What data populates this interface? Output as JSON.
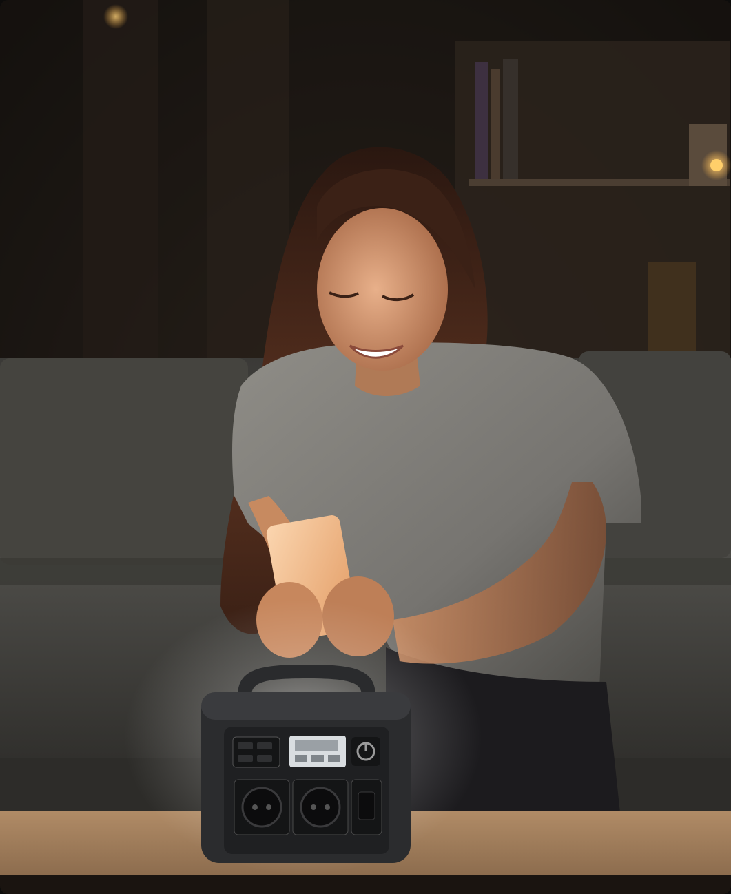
{
  "scene": {
    "description_tags": [
      "woman-on-sofa",
      "smartphone",
      "portable-power-station",
      "living-room-night"
    ],
    "palette": {
      "room_dark": "#171310",
      "wall_warm": "#2a211a",
      "sofa": "#4a4a46",
      "shirt": "#8d8b85",
      "skin": "#d49a72",
      "hair": "#3a2116",
      "table": "#a78360",
      "device_body": "#2b2c2e",
      "device_glow": "#ffffff",
      "phone_screen": "#f4c59c",
      "lamp_light": "#ffb545"
    }
  },
  "device": {
    "display_icon": "lcd-battery-display-icon",
    "power_icon": "power-button-icon",
    "outlet_icon": "ac-outlet-icon",
    "usb_icon": "usb-port-icon"
  }
}
